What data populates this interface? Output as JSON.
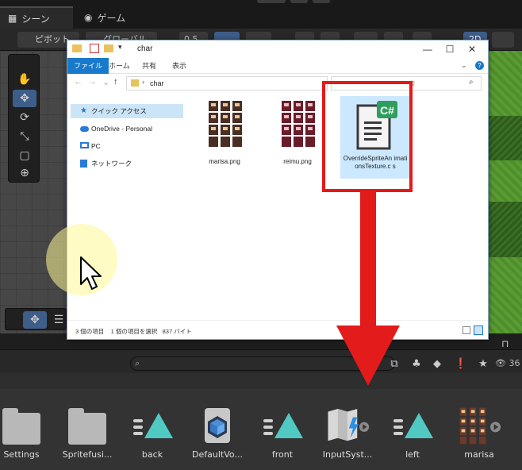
{
  "unity": {
    "tabs": {
      "scene": "シーン",
      "game": "ゲーム"
    },
    "toolbar": {
      "pivot": "ピボット",
      "global": "グローバル",
      "snap_value": "0.5",
      "mode_2d": "2D"
    },
    "project_toolbar": {
      "hidden_count": "36"
    }
  },
  "explorer": {
    "title": "char",
    "ribbon_tabs": [
      "ファイル",
      "ホーム",
      "共有",
      "表示"
    ],
    "address": "char",
    "search_placeholder": "索",
    "nav_items": [
      "クイック アクセス",
      "OneDrive - Personal",
      "PC",
      "ネットワーク"
    ],
    "files": [
      {
        "name": "marisa.png"
      },
      {
        "name": "reimu.png"
      },
      {
        "name": "OverrideSpriteAnimationsTexture.cs",
        "display": "OverrideSpriteAn imationsTexture.c s",
        "badge": "C#"
      }
    ],
    "status": {
      "count": "3 個の項目",
      "selected": "1 個の項目を選択",
      "size": "837 バイト"
    }
  },
  "assets": [
    {
      "label": "Settings",
      "icon": "folder-icon"
    },
    {
      "label": "Spritefusi...",
      "icon": "folder-icon"
    },
    {
      "label": "back",
      "icon": "animation-clip-icon"
    },
    {
      "label": "DefaultVo...",
      "icon": "volume-profile-icon"
    },
    {
      "label": "front",
      "icon": "animation-clip-icon"
    },
    {
      "label": "InputSyst...",
      "icon": "input-actions-icon"
    },
    {
      "label": "left",
      "icon": "animation-clip-icon"
    },
    {
      "label": "marisa",
      "icon": "sprite-sheet-icon"
    }
  ],
  "colors": {
    "annotation_red": "#e31b1b",
    "explorer_accent": "#1979ca",
    "selection": "#cce8ff",
    "anim_clip": "#4fc9c2"
  }
}
